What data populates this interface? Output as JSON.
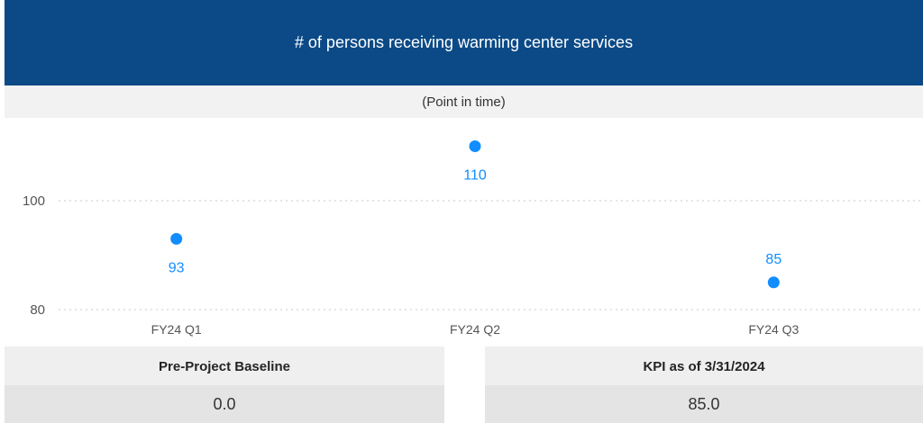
{
  "title": "# of persons receiving warming center services",
  "subtitle": "(Point in time)",
  "chart_data": {
    "type": "scatter",
    "categories": [
      "FY24 Q1",
      "FY24 Q2",
      "FY24 Q3"
    ],
    "values": [
      93,
      110,
      85
    ],
    "data_labels": [
      "93",
      "110",
      "85"
    ],
    "ylim": [
      79,
      113
    ],
    "yticks": [
      80,
      100
    ],
    "ytick_labels": [
      "80",
      "100"
    ],
    "grid": true,
    "point_color": "#118dff",
    "label_color": "#118dff"
  },
  "cards": {
    "baseline": {
      "label": "Pre-Project Baseline",
      "value": "0.0"
    },
    "kpi": {
      "label": "KPI as of 3/31/2024",
      "value": "85.0"
    }
  },
  "colors": {
    "header_bg": "#0b4a87",
    "header_text": "#ffffff"
  }
}
